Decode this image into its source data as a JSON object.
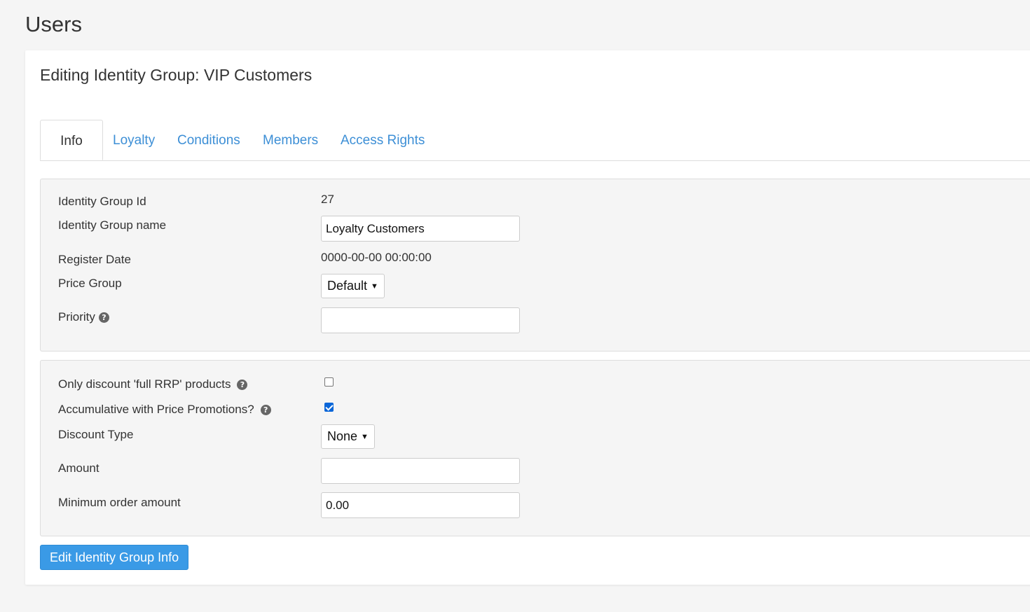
{
  "page": {
    "title": "Users"
  },
  "card": {
    "title": "Editing Identity Group: VIP Customers"
  },
  "tabs": [
    {
      "label": "Info",
      "active": true
    },
    {
      "label": "Loyalty",
      "active": false
    },
    {
      "label": "Conditions",
      "active": false
    },
    {
      "label": "Members",
      "active": false
    },
    {
      "label": "Access Rights",
      "active": false
    }
  ],
  "info_panel": {
    "group_id_label": "Identity Group Id",
    "group_id_value": "27",
    "group_name_label": "Identity Group name",
    "group_name_value": "Loyalty Customers",
    "register_date_label": "Register Date",
    "register_date_value": "0000-00-00 00:00:00",
    "price_group_label": "Price Group",
    "price_group_value": "Default",
    "priority_label": "Priority",
    "priority_value": ""
  },
  "discount_panel": {
    "full_rrp_label": "Only discount 'full RRP' products",
    "full_rrp_checked": false,
    "accumulative_label": "Accumulative with Price Promotions?",
    "accumulative_checked": true,
    "discount_type_label": "Discount Type",
    "discount_type_value": "None",
    "amount_label": "Amount",
    "amount_value": "",
    "min_order_label": "Minimum order amount",
    "min_order_value": "0.00"
  },
  "actions": {
    "submit_label": "Edit Identity Group Info"
  },
  "icons": {
    "help": "question-circle-icon",
    "caret": "caret-down-icon"
  },
  "colors": {
    "link": "#3d8fd6",
    "primary_button": "#3a9ae6",
    "checkbox_checked": "#0a66d8"
  }
}
